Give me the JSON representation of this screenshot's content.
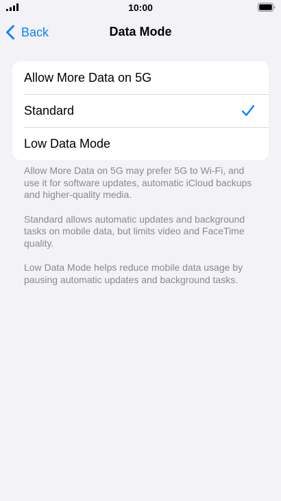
{
  "status_bar": {
    "time": "10:00",
    "signal_icon": "cellular-signal-icon",
    "battery_icon": "battery-icon"
  },
  "nav": {
    "back_label": "Back",
    "back_icon": "chevron-left-icon",
    "title": "Data Mode"
  },
  "options": [
    {
      "label": "Allow More Data on 5G",
      "selected": false
    },
    {
      "label": "Standard",
      "selected": true
    },
    {
      "label": "Low Data Mode",
      "selected": false
    }
  ],
  "notes": [
    "Allow More Data on 5G may prefer 5G to Wi-Fi, and use it for software updates, automatic iCloud backups and higher-quality media.",
    "Standard allows automatic updates and background tasks on mobile data, but limits video and FaceTime quality.",
    "Low Data Mode helps reduce mobile data usage by pausing automatic updates and background tasks."
  ],
  "colors": {
    "accent": "#0a84ff",
    "background": "#f2f2f7",
    "secondary_text": "#8a8a8e"
  }
}
